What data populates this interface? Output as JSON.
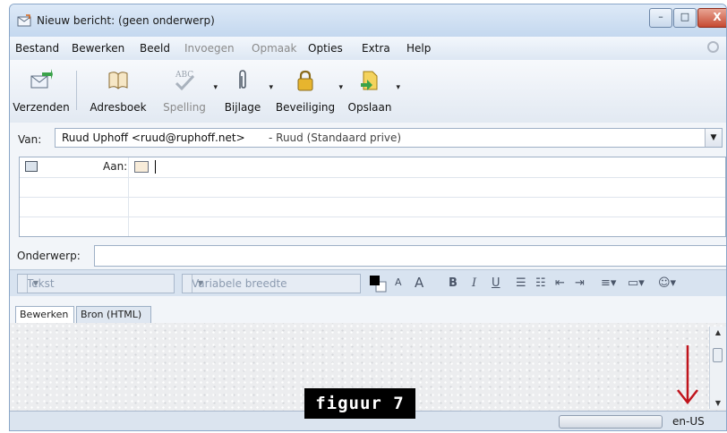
{
  "window": {
    "title": "Nieuw bericht: (geen onderwerp)",
    "controls": {
      "minimize": "–",
      "maximize": "□",
      "close": "X"
    }
  },
  "menubar": {
    "items": [
      {
        "label": "Bestand",
        "enabled": true
      },
      {
        "label": "Bewerken",
        "enabled": true
      },
      {
        "label": "Beeld",
        "enabled": true
      },
      {
        "label": "Invoegen",
        "enabled": false
      },
      {
        "label": "Opmaak",
        "enabled": false
      },
      {
        "label": "Opties",
        "enabled": true
      },
      {
        "label": "Extra",
        "enabled": true
      },
      {
        "label": "Help",
        "enabled": true
      }
    ]
  },
  "toolbar": {
    "send": "Verzenden",
    "addressbook": "Adresboek",
    "spelling": "Spelling",
    "attachment": "Bijlage",
    "security": "Beveiliging",
    "save": "Opslaan",
    "spelling_icon_text": "ABC"
  },
  "header": {
    "from_label": "Van:",
    "from_value": "Ruud Uphoff <ruud@ruphoff.net>",
    "from_identity": "- Ruud (Standaard prive)",
    "to_label": "Aan:",
    "to_value": "",
    "subject_label": "Onderwerp:",
    "subject_value": ""
  },
  "format_toolbar": {
    "paragraph_format": "Tekst",
    "font": "Variabele breedte",
    "smaller_font": "A",
    "larger_font": "A",
    "bold": "B",
    "italic": "I",
    "underline": "U"
  },
  "editor_tabs": [
    {
      "label": "Bewerken",
      "active": true
    },
    {
      "label": "Bron (HTML)",
      "active": false
    }
  ],
  "statusbar": {
    "progress": 0,
    "language": "en-US"
  },
  "annotation": {
    "caption": "figuur 7",
    "arrow_color": "#c0141c"
  }
}
